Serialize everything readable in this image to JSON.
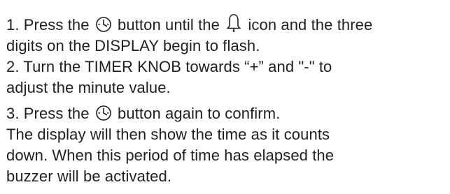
{
  "step1": {
    "part_a": "1. Press the",
    "part_b": "button until the",
    "part_c": "icon and the three",
    "line2": "digits on the DISPLAY begin to flash."
  },
  "step2": {
    "line1": "2. Turn the TIMER KNOB towards “+” and \"-\"  to",
    "line2": "adjust the minute value."
  },
  "step3": {
    "part_a": "3. Press the",
    "part_b": "button again to confirm.",
    "line2": "The display will then show the time as it counts",
    "line3": "down. When this period of time has elapsed the",
    "line4": "buzzer will be activated."
  },
  "icons": {
    "clock": "clock-icon",
    "bell": "bell-icon"
  }
}
